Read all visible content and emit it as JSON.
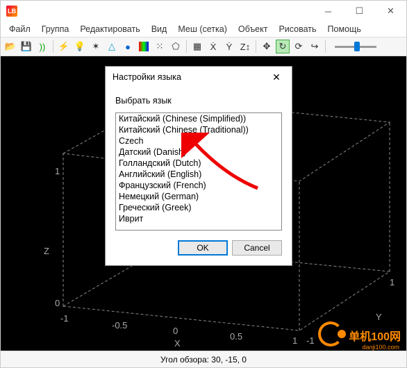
{
  "app_icon_text": "LB",
  "menubar": {
    "file": "Файл",
    "group": "Группа",
    "edit": "Редактировать",
    "view": "Вид",
    "mesh": "Меш (сетка)",
    "object": "Объект",
    "draw": "Рисовать",
    "help": "Помощь"
  },
  "dialog": {
    "title": "Настройки языка",
    "label": "Выбрать язык",
    "items": [
      "Китайский (Chinese (Simplified))",
      "Китайский (Chinese (Traditional))",
      "Czech",
      "Датский (Danish)",
      "Голландский (Dutch)",
      "Английский (English)",
      "Французский (French)",
      "Немецкий (German)",
      "Греческий (Greek)",
      "Иврит"
    ],
    "ok": "OK",
    "cancel": "Cancel"
  },
  "axes": {
    "x_label": "X",
    "y_label": "Y",
    "z_label": "Z",
    "x_ticks": [
      "-1",
      "-0.5",
      "0",
      "0.5",
      "1"
    ],
    "y_ticks": [
      "-1",
      "1"
    ],
    "z_ticks": [
      "0",
      "1"
    ]
  },
  "statusbar": "Угол обзора: 30, -15, 0",
  "watermark": {
    "text": "单机100网",
    "url": "danji100.com"
  }
}
